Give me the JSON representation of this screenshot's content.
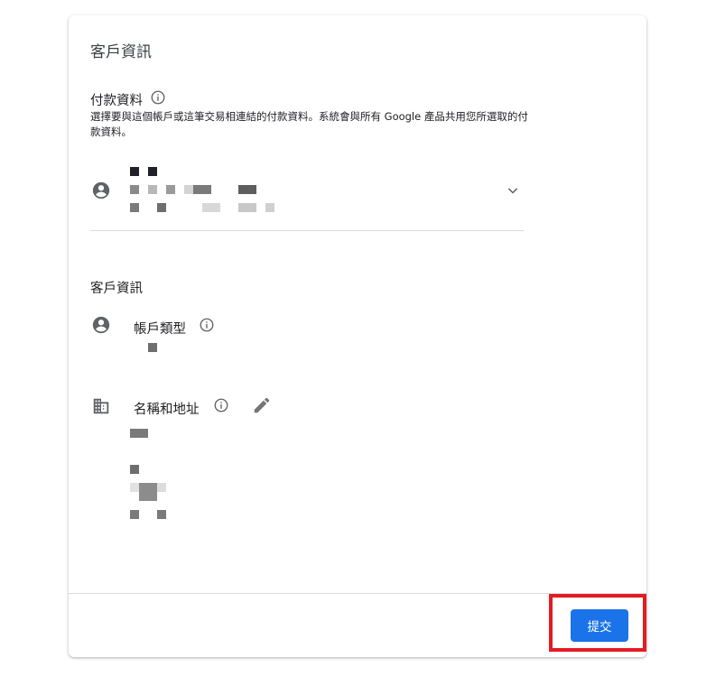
{
  "card": {
    "title": "客戶資訊"
  },
  "payment": {
    "title": "付款資料",
    "description": "選擇要與這個帳戶或這筆交易相連結的付款資料。系統會與所有 Google 產品共用您所選取的付款資料。"
  },
  "customer": {
    "heading": "客戶資訊",
    "account_type_label": "帳戶類型",
    "name_address_label": "名稱和地址"
  },
  "footer": {
    "submit_label": "提交"
  },
  "icons": {
    "info": "info-icon",
    "account": "account-circle-icon",
    "chevron": "chevron-down-icon",
    "building": "building-icon",
    "edit": "pencil-icon"
  },
  "colors": {
    "primary": "#1a73e8",
    "highlight": "#e31b23",
    "icon": "#5f6368"
  }
}
